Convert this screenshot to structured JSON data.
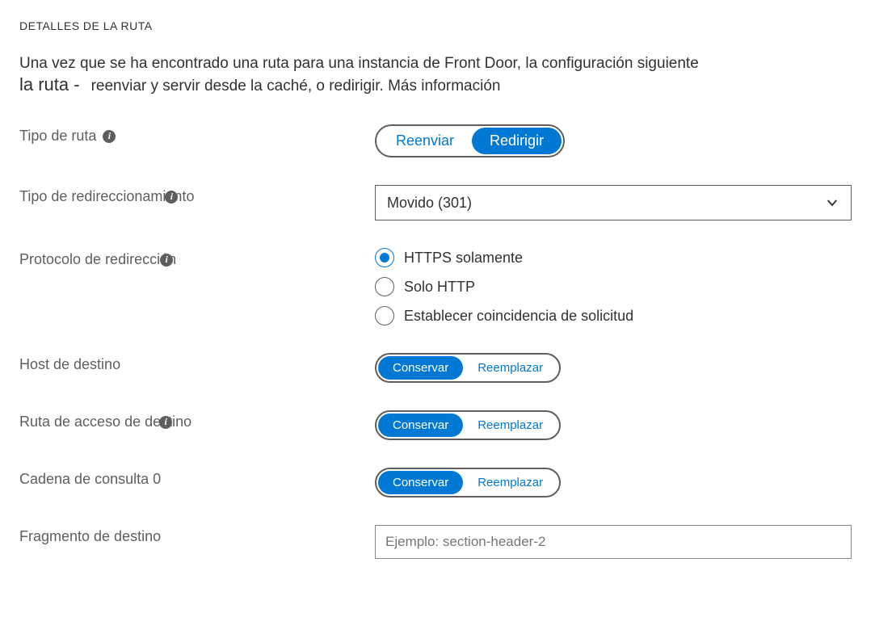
{
  "section_title": "DETALLES DE LA RUTA",
  "intro_line1": "Una vez que se ha encontrado una ruta para una instancia de Front Door, la configuración siguiente",
  "intro_line2_prefix": "la ruta -",
  "intro_line2_rest": "reenviar y servir desde la caché, o redirigir. Más información",
  "route_type": {
    "label": "Tipo de ruta",
    "options": {
      "forward": "Reenviar",
      "redirect": "Redirigir"
    },
    "selected": "redirect"
  },
  "redirect_type": {
    "label": "Tipo de redireccionamiento",
    "value": "Movido (301)"
  },
  "redirect_protocol": {
    "label": "Protocolo de redirección",
    "options": [
      {
        "key": "https",
        "label": "HTTPS solamente"
      },
      {
        "key": "http",
        "label": "Solo HTTP"
      },
      {
        "key": "match",
        "label": "Establecer coincidencia de solicitud"
      }
    ],
    "selected": "https"
  },
  "dest_host": {
    "label": "Host de destino",
    "options": {
      "keep": "Conservar",
      "replace": "Reemplazar"
    },
    "selected": "keep"
  },
  "dest_path": {
    "label": "Ruta de acceso de destino",
    "options": {
      "keep": "Conservar",
      "replace": "Reemplazar"
    },
    "selected": "keep"
  },
  "query_string": {
    "label": "Cadena de consulta 0",
    "options": {
      "keep": "Conservar",
      "replace": "Reemplazar"
    },
    "selected": "keep"
  },
  "dest_fragment": {
    "label": "Fragmento de destino",
    "placeholder": "Ejemplo: section-header-2"
  }
}
